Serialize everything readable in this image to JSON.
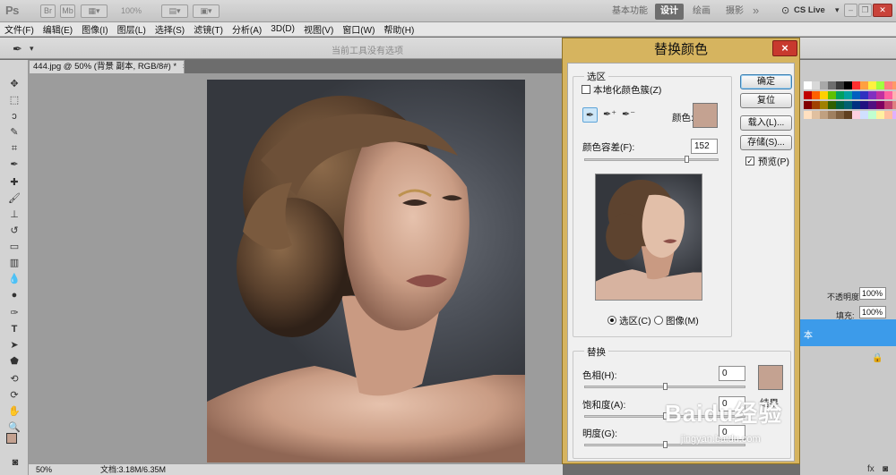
{
  "app": {
    "logo": "Ps",
    "zoom": "100%",
    "workspaces": [
      "基本功能",
      "设计",
      "绘画",
      "摄影"
    ],
    "active_workspace": "设计",
    "cslive": "CS Live"
  },
  "menu": [
    "文件(F)",
    "编辑(E)",
    "图像(I)",
    "图层(L)",
    "选择(S)",
    "滤镜(T)",
    "分析(A)",
    "3D(D)",
    "视图(V)",
    "窗口(W)",
    "帮助(H)"
  ],
  "options": {
    "hint": "当前工具没有选项"
  },
  "document": {
    "tab_title": "444.jpg @ 50% (背景 副本, RGB/8#) *",
    "close": "×"
  },
  "status": {
    "zoom": "50%",
    "doc_info": "文档:3.18M/6.35M"
  },
  "dialog": {
    "title": "替换颜色",
    "close": "×",
    "selection": {
      "group_label": "选区",
      "localized_label": "本地化颜色簇(Z)",
      "localized_checked": false,
      "color_label": "颜色:",
      "color_swatch": "#c4a291",
      "fuzziness_label": "颜色容差(F):",
      "fuzziness_value": "152",
      "fuzziness_fraction": 0.76,
      "view_selection": "选区(C)",
      "view_image": "图像(M)",
      "view_mode": "selection"
    },
    "buttons": {
      "ok": "确定",
      "reset": "复位",
      "load": "载入(L)...",
      "save": "存储(S)..."
    },
    "preview": {
      "label": "预览(P)",
      "checked": true
    },
    "replace": {
      "group_label": "替换",
      "hue_label": "色相(H):",
      "hue_value": "0",
      "saturation_label": "饱和度(A):",
      "saturation_value": "0",
      "lightness_label": "明度(G):",
      "lightness_value": "0",
      "result_label": "结果",
      "result_swatch": "#c4a291"
    }
  },
  "panels": {
    "opacity_label": "不透明度:",
    "opacity_value": "100%",
    "fill_label": "填充:",
    "fill_value": "100%",
    "layer_name": "本"
  },
  "watermark": {
    "brand": "Baidu经验",
    "url": "jingyan.baidu.com"
  },
  "colors": {
    "accent": "#d6b45f",
    "close": "#c8392e",
    "layer_selected": "#3c9bea",
    "foreground": "#c4a291",
    "background": "#000000"
  }
}
